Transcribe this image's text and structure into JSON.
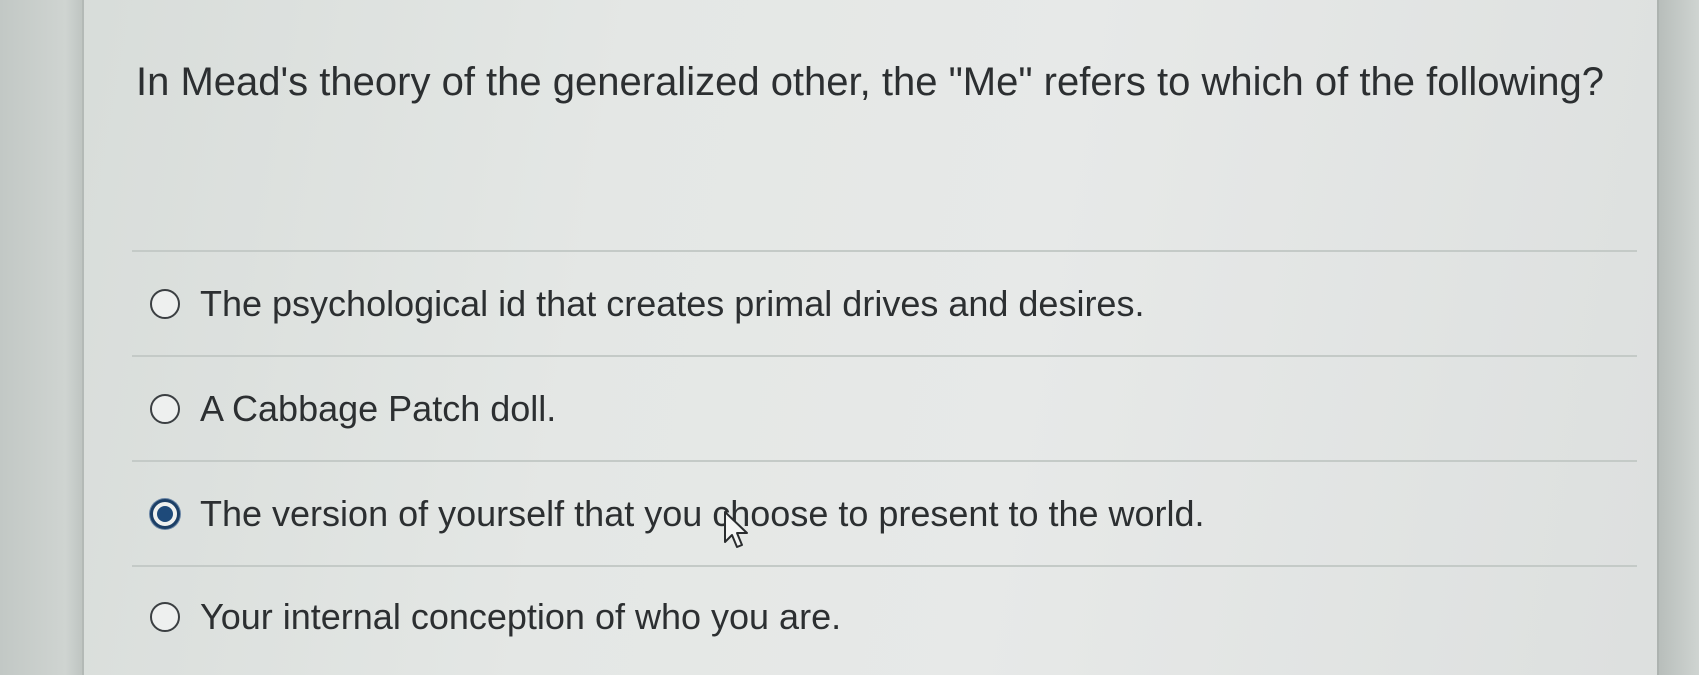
{
  "question": {
    "text": "In Mead's theory of the generalized other, the \"Me\" refers to which of the following?"
  },
  "options": [
    {
      "label": "The psychological id that creates primal drives and desires.",
      "selected": false
    },
    {
      "label": "A Cabbage Patch doll.",
      "selected": false
    },
    {
      "label": "The version of yourself that you choose to present to the world.",
      "selected": true
    },
    {
      "label": "Your internal conception of who you are.",
      "selected": false
    }
  ],
  "colors": {
    "selected_radio": "#1e4a7a",
    "text": "#2c2f31"
  },
  "icons": {
    "cursor": "mouse-pointer-icon"
  }
}
